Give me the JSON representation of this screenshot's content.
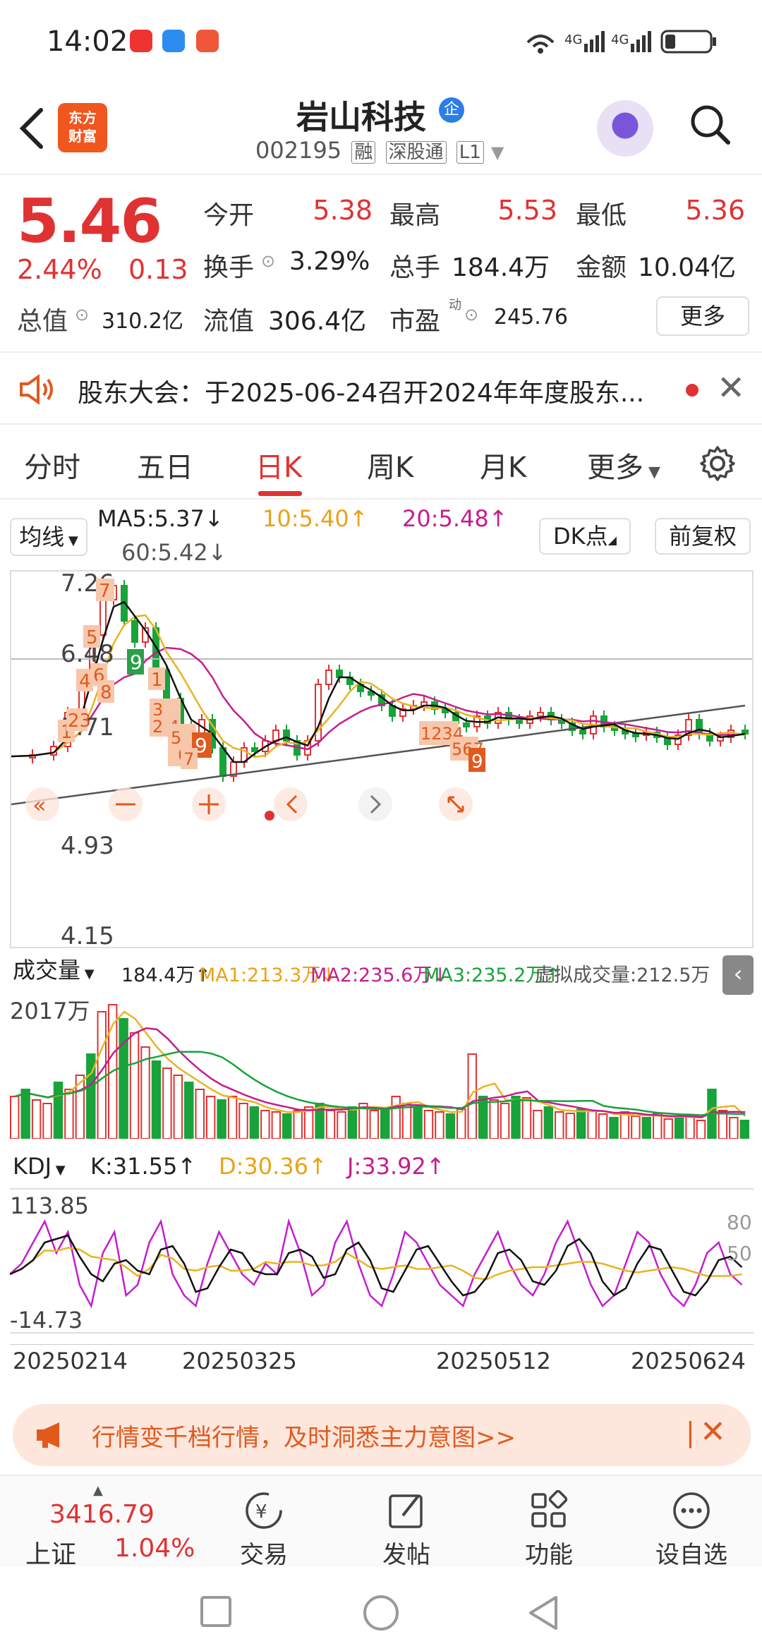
{
  "status_bar": {
    "time": "14:02",
    "network": "4G 4G"
  },
  "header": {
    "back_icon": "chevron-left-icon",
    "logo_text": "东方财富",
    "stock_name": "岩山科技",
    "badge": "企",
    "code": "002195",
    "tags": [
      "融",
      "深股通",
      "L1"
    ]
  },
  "quote": {
    "price": "5.46",
    "change_pct": "2.44%",
    "change": "0.13",
    "labels": {
      "open": "今开",
      "high": "最高",
      "low": "最低",
      "turnover": "换手",
      "volume": "总手",
      "amount": "金额",
      "total_mv": "总值",
      "float_mv": "流值",
      "pe": "市盈",
      "pe_sup": "动"
    },
    "open": "5.38",
    "high": "5.53",
    "low": "5.36",
    "turnover": "3.29%",
    "volume": "184.4万",
    "amount": "10.04亿",
    "total_mv": "310.2亿",
    "float_mv": "306.4亿",
    "pe": "245.76",
    "more": "更多"
  },
  "notice": {
    "text": "股东大会：于2025-06-24召开2024年年度股东..."
  },
  "tabs": [
    "分时",
    "五日",
    "日K",
    "周K",
    "月K",
    "更多"
  ],
  "active_tab": "日K",
  "ma_row": {
    "select": "均线",
    "ma5": "MA5:5.37↓",
    "ma10": "10:5.40↑",
    "ma20": "20:5.48↑",
    "ma60": "60:5.42↓",
    "dk": "DK点",
    "fq": "前复权"
  },
  "chart_axis": {
    "y_high": "7.26",
    "y_mid1": "6.48",
    "y_mid2": "5.71",
    "y_mid3": "4.93",
    "y_low": "4.15"
  },
  "volume": {
    "select": "成交量",
    "vol": "184.4万↑",
    "ma1": "MA1:213.3万↓",
    "ma2": "MA2:235.6万↓",
    "ma3": "MA3:235.2万↑",
    "virtual": "虚拟成交量:212.5万",
    "y_max": "2017万"
  },
  "kdj": {
    "select": "KDJ",
    "k": "K:31.55↑",
    "d": "D:30.36↑",
    "j": "J:33.92↑",
    "y_max": "113.85",
    "y_min": "-14.73",
    "right_80": "80",
    "right_50": "50"
  },
  "dates": [
    "20250214",
    "20250325",
    "20250512",
    "20250624"
  ],
  "promo": {
    "text": "行情变千档行情，及时洞悉主力意图>>"
  },
  "bottom_nav": {
    "index_value": "3416.79",
    "index_name": "上证",
    "index_pct": "1.04%",
    "items": [
      "交易",
      "发帖",
      "功能",
      "设自选"
    ]
  },
  "colors": {
    "up": "#e03232",
    "down": "#18a33b",
    "accent": "#e05a1e"
  }
}
